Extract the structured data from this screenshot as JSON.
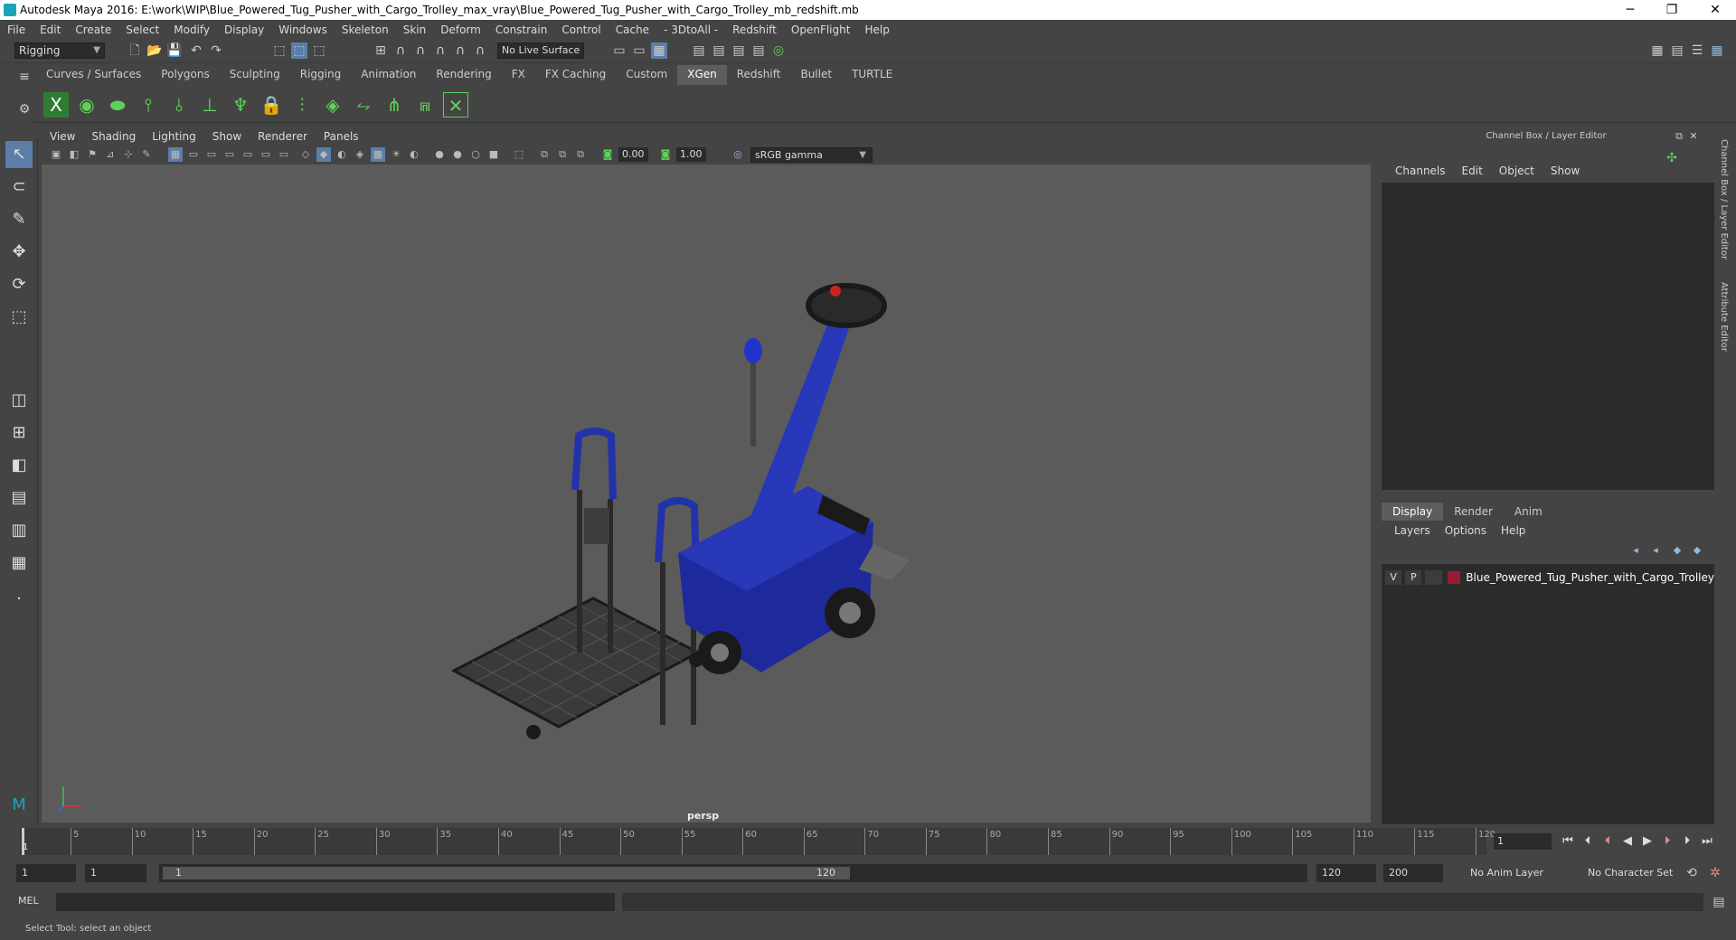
{
  "titlebar": {
    "title": "Autodesk Maya 2016: E:\\work\\WIP\\Blue_Powered_Tug_Pusher_with_Cargo_Trolley_max_vray\\Blue_Powered_Tug_Pusher_with_Cargo_Trolley_mb_redshift.mb",
    "minimize": "─",
    "restore": "❐",
    "close": "✕"
  },
  "menubar": [
    "File",
    "Edit",
    "Create",
    "Select",
    "Modify",
    "Display",
    "Windows",
    "Skeleton",
    "Skin",
    "Deform",
    "Constrain",
    "Control",
    "Cache",
    "- 3DtoAll -",
    "Redshift",
    "OpenFlight",
    "Help"
  ],
  "statusline": {
    "mode": "Rigging",
    "live_surface": "No Live Surface"
  },
  "shelf_tabs": [
    "Curves / Surfaces",
    "Polygons",
    "Sculpting",
    "Rigging",
    "Animation",
    "Rendering",
    "FX",
    "FX Caching",
    "Custom",
    "XGen",
    "Redshift",
    "Bullet",
    "TURTLE"
  ],
  "shelf_active": "XGen",
  "viewport": {
    "menu": [
      "View",
      "Shading",
      "Lighting",
      "Show",
      "Renderer",
      "Panels"
    ],
    "exposure": "0.00",
    "gamma_value": "1.00",
    "color_space": "sRGB gamma",
    "camera_label": "persp"
  },
  "channel_box": {
    "header": "Channel Box / Layer Editor",
    "menu": [
      "Channels",
      "Edit",
      "Object",
      "Show"
    ]
  },
  "layer_editor": {
    "tabs": [
      "Display",
      "Render",
      "Anim"
    ],
    "active_tab": "Display",
    "menu": [
      "Layers",
      "Options",
      "Help"
    ],
    "layers": [
      {
        "v": "V",
        "p": "P",
        "name": "Blue_Powered_Tug_Pusher_with_Cargo_Trolley",
        "color": "#9b1b35"
      }
    ]
  },
  "side_tabs": [
    "Channel Box / Layer Editor",
    "Attribute Editor"
  ],
  "timeline": {
    "ticks": [
      5,
      10,
      15,
      20,
      25,
      30,
      35,
      40,
      45,
      50,
      55,
      60,
      65,
      70,
      75,
      80,
      85,
      90,
      95,
      100,
      105,
      110,
      115,
      120
    ],
    "min": 1,
    "max": 120,
    "current_frame_marker": "1",
    "current_frame": "1"
  },
  "range": {
    "start": "1",
    "playback_start": "1",
    "slider_start": "1",
    "slider_end": "120",
    "playback_end": "120",
    "end": "200",
    "anim_layer": "No Anim Layer",
    "character_set": "No Character Set"
  },
  "command": {
    "label": "MEL"
  },
  "help_line": "Select Tool: select an object"
}
